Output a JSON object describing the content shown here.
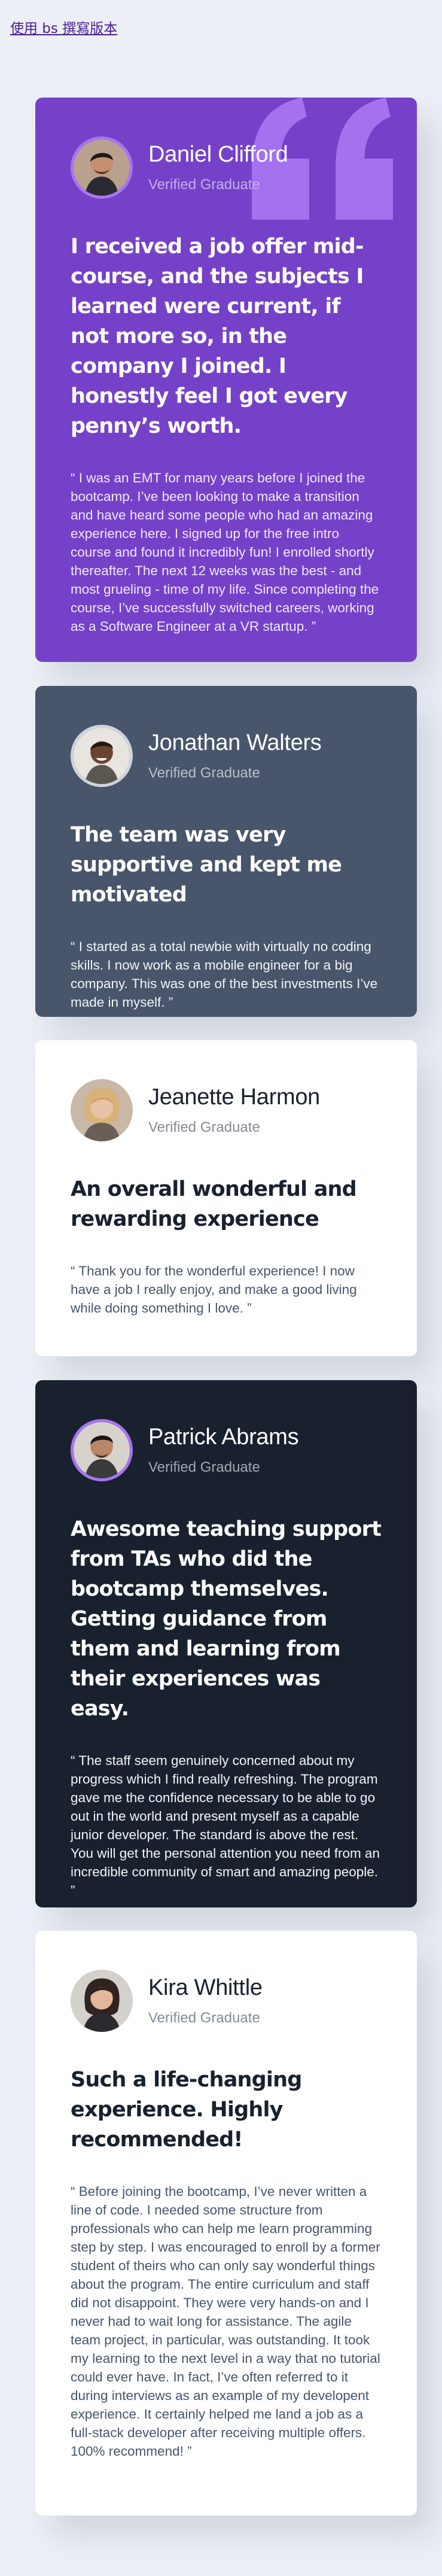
{
  "top_link": "使用 bs 撰寫版本",
  "testimonials": [
    {
      "name": "Daniel Clifford",
      "role": "Verified Graduate",
      "headline": "I received a job offer mid-course, and the subjects I learned were current, if not more so, in the company I joined. I honestly feel I got every penny’s worth.",
      "quote": "“ I was an EMT for many years before I joined the bootcamp. I’ve been looking to make a transition and have heard some people who had an amazing experience here. I signed up for the free intro course and found it incredibly fun! I enrolled shortly thereafter. The next 12 weeks was the best - and most grueling - time of my life. Since completing the course, I’ve successfully switched careers, working as a Software Engineer at a VR startup. ”"
    },
    {
      "name": "Jonathan Walters",
      "role": "Verified Graduate",
      "headline": "The team was very supportive and kept me motivated",
      "quote": "“ I started as a total newbie with virtually no coding skills. I now work as a mobile engineer for a big company. This was one of the best investments I’ve made in myself. ”"
    },
    {
      "name": "Jeanette Harmon",
      "role": "Verified Graduate",
      "headline": "An overall wonderful and rewarding experience",
      "quote": "“ Thank you for the wonderful experience! I now have a job I really enjoy, and make a good living while doing something I love. ”"
    },
    {
      "name": "Patrick Abrams",
      "role": "Verified Graduate",
      "headline": "Awesome teaching support from TAs who did the bootcamp themselves. Getting guidance from them and learning from their experiences was easy.",
      "quote": "“ The staff seem genuinely concerned about my progress which I find really refreshing. The program gave me the confidence necessary to be able to go out in the world and present myself as a capable junior developer. The standard is above the rest. You will get the personal attention you need from an incredible community of smart and amazing people. ”"
    },
    {
      "name": "Kira Whittle",
      "role": "Verified Graduate",
      "headline": "Such a life-changing experience. Highly recommended!",
      "quote": "“ Before joining the bootcamp, I’ve never written a line of code. I needed some structure from professionals who can help me learn programming step by step. I was encouraged to enroll by a former student of theirs who can only say wonderful things about the program. The entire curriculum and staff did not disappoint. They were very hands-on and I never had to wait long for assistance. The agile team project, in particular, was outstanding. It took my learning to the next level in a way that no tutorial could ever have. In fact, I’ve often referred to it during interviews as an example of my developent experience. It certainly helped me land a job as a full-stack developer after receiving multiple offers. 100% recommend! ”"
    }
  ]
}
